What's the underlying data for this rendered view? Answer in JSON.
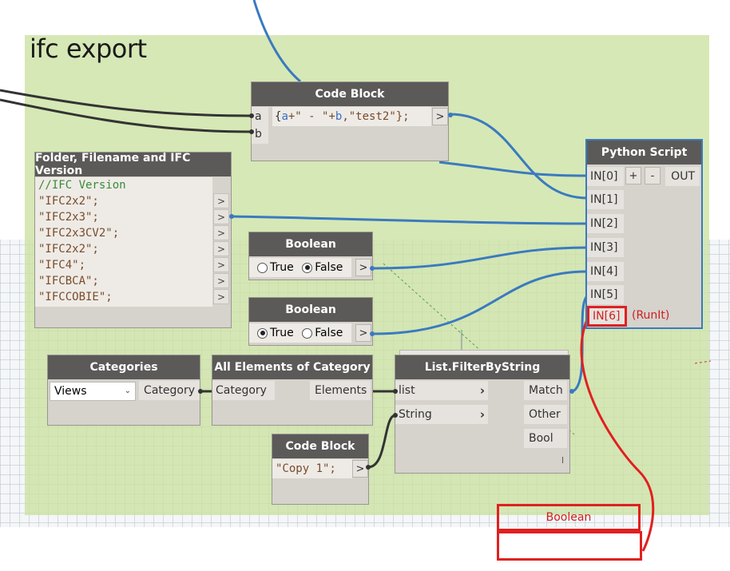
{
  "group": {
    "title": "ifc export"
  },
  "code_block_1": {
    "title": "Code Block",
    "port_a": "a",
    "port_b": "b",
    "code_parts": [
      "{",
      "a",
      "+\" - \"+",
      "b",
      ",\"test2\"};"
    ],
    "out": ">"
  },
  "python_script": {
    "title": "Python Script",
    "inputs": [
      "IN[0]",
      "IN[1]",
      "IN[2]",
      "IN[3]",
      "IN[4]",
      "IN[5]",
      "IN[6]"
    ],
    "add": "+",
    "remove": "-",
    "output": "OUT",
    "runit": "(RunIt)"
  },
  "folder_node": {
    "title": "Folder, Filename and IFC Version",
    "comment": "//IFC Version",
    "items": [
      "\"IFC2x2\";",
      "\"IFC2x3\";",
      "\"IFC2x3CV2\";",
      "\"IFC2x2\";",
      "\"IFC4\";",
      "\"IFCBCA\";",
      "\"IFCCOBIE\";"
    ],
    "arrow": ">"
  },
  "boolean_1": {
    "title": "Boolean",
    "true_label": "True",
    "false_label": "False",
    "selected": "False",
    "out": ">"
  },
  "boolean_2": {
    "title": "Boolean",
    "true_label": "True",
    "false_label": "False",
    "selected": "True",
    "out": ">"
  },
  "categories": {
    "title": "Categories",
    "selected": "Views",
    "output": "Category"
  },
  "all_elements": {
    "title": "All Elements of Category",
    "input": "Category",
    "output": "Elements"
  },
  "filter": {
    "title": "List.FilterByString",
    "in_list": "list",
    "in_string": "String",
    "out_match": "Match",
    "out_other": "Other",
    "out_bool": "Bool",
    "lacing": "l"
  },
  "code_block_2": {
    "title": "Code Block",
    "code": "\"Copy 1\";",
    "out": ">"
  },
  "annotation": {
    "label": "Boolean"
  },
  "colors": {
    "wire": "#3a7abf",
    "highlight": "#e02020",
    "group": "#cbe1a0",
    "header": "#5b5a58"
  }
}
